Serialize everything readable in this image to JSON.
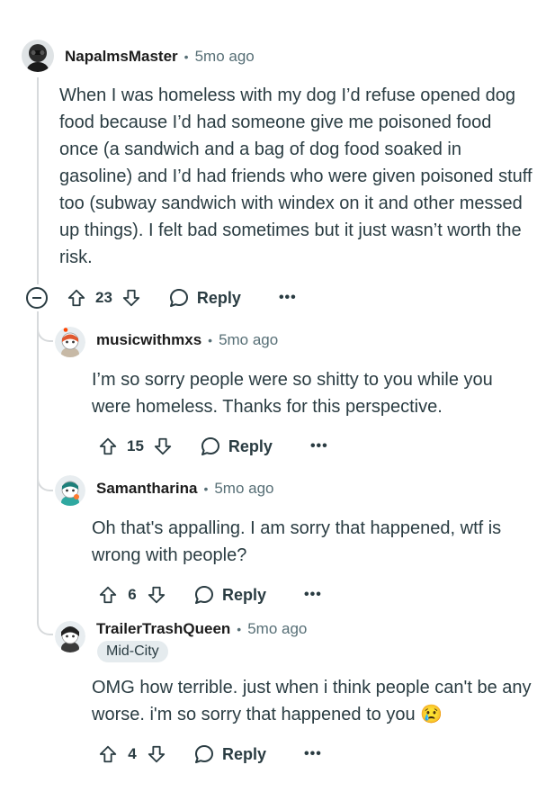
{
  "comments": [
    {
      "username": "NapalmsMaster",
      "time": "5mo ago",
      "text": "When I was homeless with my dog I’d refuse opened dog food because I’d had someone give me poisoned food once (a sandwich and a bag of dog food soaked in gasoline) and I’d had friends who were given poisoned stuff too (subway sandwich with windex on it and other messed up things). I felt bad sometimes but it just wasn’t worth the risk.",
      "score": "23",
      "reply_label": "Reply",
      "more_label": "•••"
    },
    {
      "username": "musicwithmxs",
      "time": "5mo ago",
      "text": "I’m so sorry people were so shitty to you while you were homeless. Thanks for this perspective.",
      "score": "15",
      "reply_label": "Reply",
      "more_label": "•••"
    },
    {
      "username": "Samantharina",
      "time": "5mo ago",
      "text": "Oh that's appalling. I am sorry that happened, wtf is wrong with people?",
      "score": "6",
      "reply_label": "Reply",
      "more_label": "•••"
    },
    {
      "username": "TrailerTrashQueen",
      "time": "5mo ago",
      "flair": "Mid-City",
      "text": "OMG how terrible. just when i think people can't be any worse. i'm so sorry that happened to you 😢",
      "score": "4",
      "reply_label": "Reply",
      "more_label": "•••"
    }
  ],
  "separator": "•",
  "icons": {
    "upvote": "arrow-up-icon",
    "downvote": "arrow-down-icon",
    "reply": "speech-bubble-icon",
    "collapse": "minus-circle-icon"
  },
  "colors": {
    "text": "#2a3c42",
    "meta": "#576f76",
    "thread_line": "#d7dadc",
    "flair_bg": "#e5ebee"
  }
}
